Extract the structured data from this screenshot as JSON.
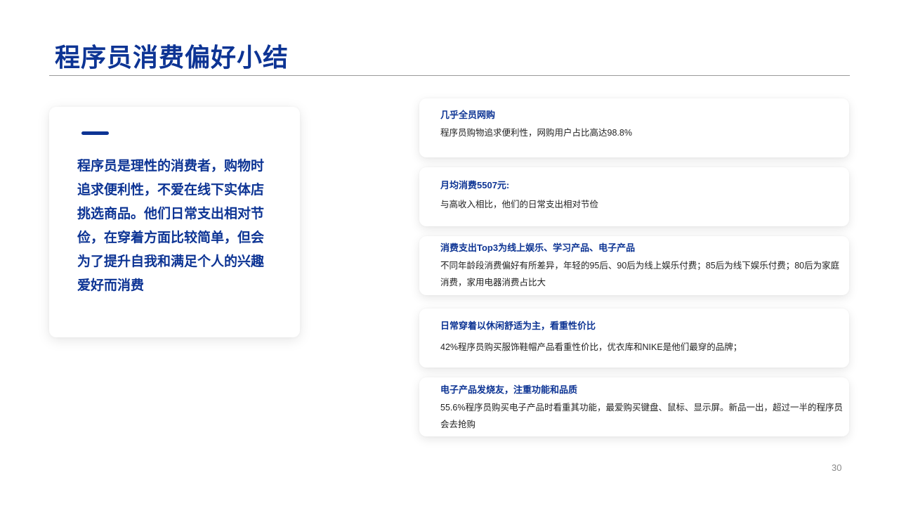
{
  "title": "程序员消费偏好小结",
  "summary": {
    "text": "程序员是理性的消费者，购物时追求便利性，不爱在线下实体店挑选商品。他们日常支出相对节俭，在穿着方面比较简单，但会为了提升自我和满足个人的兴趣爱好而消费"
  },
  "cards": [
    {
      "title": "几乎全员网购",
      "body": "程序员购物追求便利性，网购用户占比高达98.8%"
    },
    {
      "title": "月均消费5507元:",
      "body": "与高收入相比，他们的日常支出相对节俭"
    },
    {
      "title": "消费支出Top3为线上娱乐、学习产品、电子产品",
      "body": "不同年龄段消费偏好有所差异，年轻的95后、90后为线上娱乐付费；85后为线下娱乐付费；80后为家庭消费，家用电器消费占比大"
    },
    {
      "title": "日常穿着以休闲舒适为主，看重性价比",
      "body": "42%程序员购买服饰鞋帽产品看重性价比，优衣库和NIKE是他们最穿的品牌；"
    },
    {
      "title": "电子产品发烧友，注重功能和品质",
      "body": "55.6%程序员购买电子产品时看重其功能，最爱购买键盘、鼠标、显示屏。新品一出，超过一半的程序员会去抢购"
    }
  ],
  "page_number": "30",
  "colors": {
    "accent": "#0d3494",
    "body_text": "#222222",
    "divider": "#9a9a9a"
  }
}
